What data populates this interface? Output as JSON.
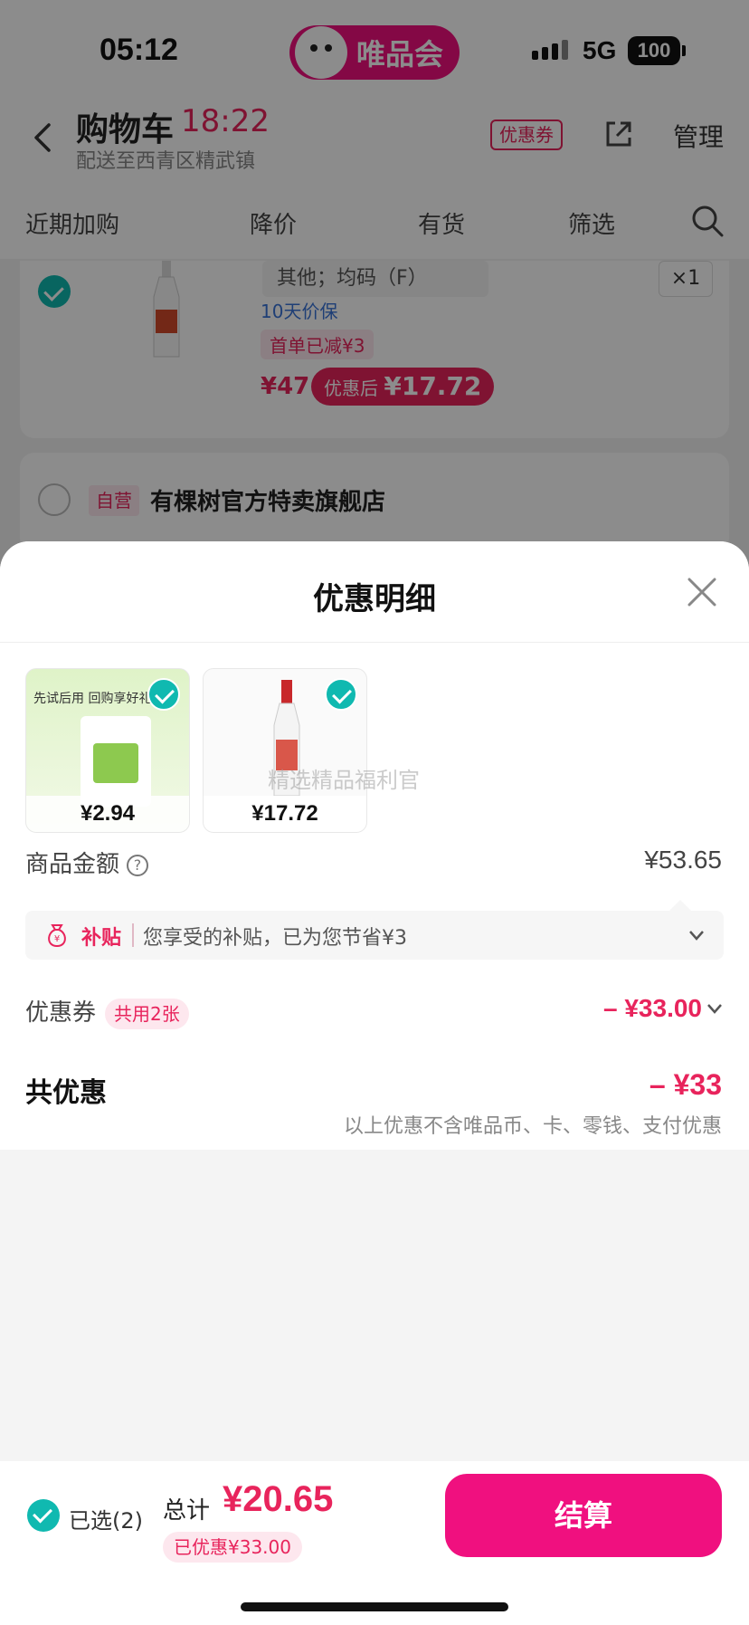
{
  "status_bar": {
    "time": "05:12",
    "brand": "唯品会",
    "network": "5G",
    "battery": "100"
  },
  "cart_header": {
    "title": "购物车",
    "timer": "18:22",
    "address": "配送至西青区精武镇",
    "coupon_tag": "优惠券",
    "manage_label": "管理"
  },
  "filters": {
    "recent": "近期加购",
    "price_drop": "降价",
    "in_stock": "有货",
    "filter": "筛选"
  },
  "cart_item": {
    "sku": "其他；均码（F）",
    "quantity": "×1",
    "price_protect": "10天价保",
    "first_order": "首单已减¥3",
    "price": "¥47",
    "after_label": "优惠后",
    "after_price": "¥17.72"
  },
  "store": {
    "self_tag": "自营",
    "name": "有棵树官方特卖旗舰店"
  },
  "sheet": {
    "title": "优惠明细",
    "products": [
      {
        "banner": "先试后用 回购享好礼",
        "price": "¥2.94"
      },
      {
        "price": "¥17.72"
      }
    ],
    "watermark": "精选精品福利官",
    "goods_amount_label": "商品金额",
    "goods_amount_value": "¥53.65",
    "subsidy_tag": "补贴",
    "subsidy_text": "您享受的补贴，已为您节省¥3",
    "coupon_label": "优惠券",
    "coupon_count": "共用2张",
    "coupon_amount": "– ¥33.00",
    "total_discount_label": "共优惠",
    "total_discount_value": "– ¥33",
    "total_discount_note": "以上优惠不含唯品币、卡、零钱、支付优惠"
  },
  "bottom_bar": {
    "selected_label": "已选(2)",
    "sum_label": "总计",
    "sum_value": "¥20.65",
    "saved_label": "已优惠¥33.00",
    "checkout_label": "结算"
  },
  "colors": {
    "brand_pink": "#f0107f",
    "accent_red": "#e8245c",
    "check_teal": "#10b9b0"
  }
}
